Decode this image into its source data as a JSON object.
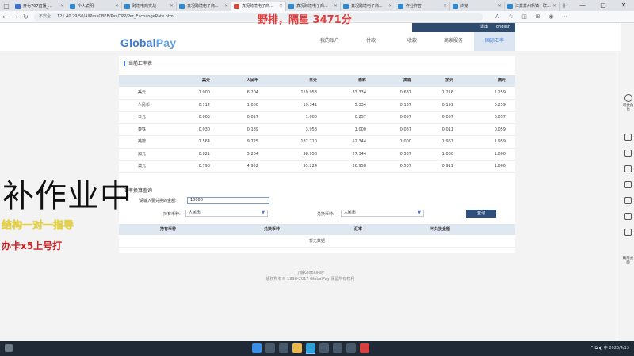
{
  "browser": {
    "tabs": [
      {
        "label": "开七707直播_...",
        "fav": "blue"
      },
      {
        "label": "个人说明",
        "fav": "blue2"
      },
      {
        "label": "跨境电商实战",
        "fav": "blue2"
      },
      {
        "label": "真况跨境电子商...",
        "fav": "blue2"
      },
      {
        "label": "真况跨境电子商...",
        "fav": "red"
      },
      {
        "label": "真况跨境电子商...",
        "fav": "blue2"
      },
      {
        "label": "真况跨境电子商...",
        "fav": "blue2"
      },
      {
        "label": "作业作答",
        "fav": "blue2"
      },
      {
        "label": "浏览",
        "fav": "blue2"
      },
      {
        "label": "江苏苏州新镇 - 联...",
        "fav": "blue2"
      }
    ],
    "insecure_label": "不安全",
    "url": "121.40.29.50/AllPassCBEB/Pay/TPP/Per_ExchangeRate.html"
  },
  "overlay": {
    "title": "野排，隔星 3471分",
    "big_text": "补作业中",
    "yellow_text": "结构一对一指导",
    "red_text": "办卡x5上号打"
  },
  "site": {
    "logo_global": "Global",
    "logo_pay": "Pay",
    "top_links": {
      "logout": "退出",
      "lang": "English"
    },
    "nav": [
      {
        "label": "我的账户",
        "active": false
      },
      {
        "label": "付款",
        "active": false
      },
      {
        "label": "收款",
        "active": false
      },
      {
        "label": "商家服务",
        "active": false
      },
      {
        "label": "国际汇率",
        "active": true
      }
    ]
  },
  "rates": {
    "title": "当前汇率表",
    "currencies": [
      "美元",
      "人民币",
      "日元",
      "英镑",
      "澳元",
      "欧元",
      "港元"
    ],
    "col_headers": [
      "美元",
      "人民币",
      "日元",
      "泰铢",
      "英镑",
      "加元",
      "澳元"
    ],
    "rows": [
      {
        "label": "美元",
        "values": [
          "1.000",
          "6.204",
          "119.958",
          "33.334",
          "0.637",
          "1.216",
          "1.259"
        ]
      },
      {
        "label": "人民币",
        "values": [
          "0.112",
          "1.000",
          "19.341",
          "5.334",
          "0.137",
          "0.191",
          "0.259"
        ]
      },
      {
        "label": "日元",
        "values": [
          "0.003",
          "0.017",
          "1.000",
          "0.257",
          "0.057",
          "0.057",
          "0.057"
        ]
      },
      {
        "label": "泰铢",
        "values": [
          "0.030",
          "0.189",
          "3.958",
          "1.000",
          "0.087",
          "0.011",
          "0.059"
        ]
      },
      {
        "label": "英镑",
        "values": [
          "1.564",
          "9.725",
          "187.710",
          "52.344",
          "1.000",
          "1.961",
          "1.959"
        ]
      },
      {
        "label": "加元",
        "values": [
          "0.821",
          "5.204",
          "98.958",
          "27.344",
          "0.537",
          "1.000",
          "1.000"
        ]
      },
      {
        "label": "澳元",
        "values": [
          "0.798",
          "4.952",
          "95.224",
          "26.958",
          "0.537",
          "0.911",
          "1.000"
        ]
      }
    ]
  },
  "converter": {
    "title": "汇率换算查询",
    "amount_label": "请输入要兑换的金额:",
    "amount_value": "10000",
    "from_label": "持有币种:",
    "from_value": "人民币",
    "to_label": "兑换币种:",
    "to_value": "人民币",
    "query_button": "查询",
    "result_headers": [
      "持有币种",
      "兑换币种",
      "汇率",
      "可兑换金额"
    ],
    "empty_text": "暂无数据"
  },
  "footer": {
    "line1": "了解GlobalPay",
    "line2": "版权所有© 1998-2017 GlobalPay 保留所有权利"
  },
  "sidebar": {
    "switch_role": "切换角色",
    "lite_mode": "精简桌面"
  },
  "taskbar": {
    "tray": "^ ⧉ ◐ 中  2023/4/13"
  }
}
